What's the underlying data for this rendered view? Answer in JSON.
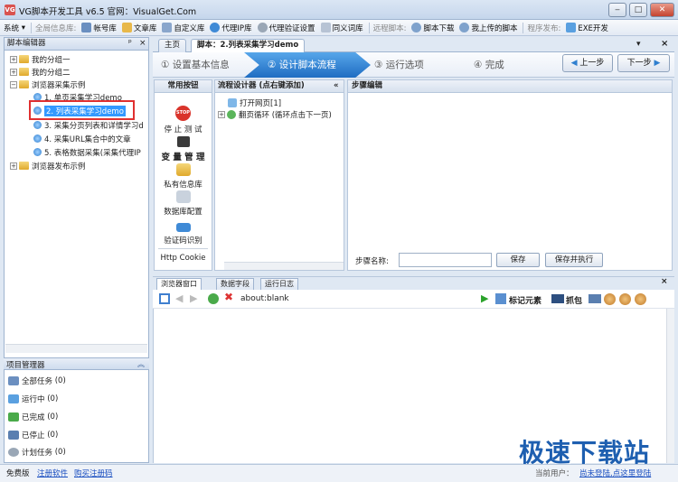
{
  "window": {
    "title": "VG脚本开发工具 v6.5 官网：VisualGet.Com",
    "app_icon": "VG"
  },
  "toolbar": {
    "system": "系统",
    "global_label": "全局信息库:",
    "account": "帐号库",
    "article": "文章库",
    "custom": "自定义库",
    "proxy_ip": "代理IP库",
    "proxy_verify": "代理验证设置",
    "synonym": "同义词库",
    "remote_label": "远程脚本:",
    "script_download": "脚本下载",
    "my_upload": "我上传的脚本",
    "publish_label": "程序发布:",
    "exe_dev": "EXE开发"
  },
  "left_panel": {
    "title": "脚本编辑器",
    "pin": "ᵖ",
    "close": "×",
    "tree": {
      "group1": "我的分组一",
      "group2": "我的分组二",
      "browser_samples": "浏览器采集示例",
      "item1": "1. 单页采集学习demo",
      "item2": "2. 列表采集学习demo",
      "item3": "3. 采集分页列表和详情学习d",
      "item4": "4. 采集URL集合中的文章",
      "item5": "5. 表格数据采集(采集代理IP",
      "publish_samples": "浏览器发布示例"
    }
  },
  "project_manager": {
    "title": "项目管理器",
    "collapse": "︽",
    "items": [
      {
        "label": "全部任务",
        "count": "(0)"
      },
      {
        "label": "运行中",
        "count": "(0)"
      },
      {
        "label": "已完成",
        "count": "(0)"
      },
      {
        "label": "已停止",
        "count": "(0)"
      },
      {
        "label": "计划任务",
        "count": "(0)"
      }
    ]
  },
  "status": {
    "edition": "免费版",
    "register": "注册软件",
    "buy": "购买注册码",
    "current_user": "当前用户：",
    "user_link": "尚未登陆,点这里登陆"
  },
  "main_tabs": {
    "home": "主页",
    "script": "脚本：2.列表采集学习demo",
    "close": "×",
    "dropdown": "▾"
  },
  "wizard": {
    "step1": "① 设置基本信息",
    "step2": "② 设计脚本流程",
    "step3": "③ 运行选项",
    "step4": "④ 完成",
    "prev": "上一步",
    "next": "下一步"
  },
  "common": {
    "title": "常用按钮",
    "stop_badge": "STOP",
    "stop": "停 止 测 试",
    "var_mgmt": "变 量 管 理",
    "private_lib": "私有信息库",
    "db_config": "数据库配置",
    "captcha": "验证码识别",
    "http_cookie": "Http Cookie"
  },
  "flow": {
    "title": "流程设计器 (点右键添加)",
    "collapse": "«",
    "node1": "打开网页[1]",
    "node2": "翻页循环 (循环点击下一页)"
  },
  "step_editor": {
    "title": "步骤编辑",
    "name_label": "步骤名称:",
    "name_value": "",
    "save": "保存",
    "save_run": "保存并执行"
  },
  "browser": {
    "tab_window": "浏览器窗口",
    "tab_fields": "数据字段",
    "tab_log": "运行日志",
    "address": "about:blank",
    "mark_elements": "标记元素",
    "capture": "抓包",
    "close": "×"
  },
  "watermark": "极速下载站",
  "colors": {
    "accent": "#1f6dc2",
    "selection": "#3399ff",
    "highlight_box": "#e03030"
  }
}
